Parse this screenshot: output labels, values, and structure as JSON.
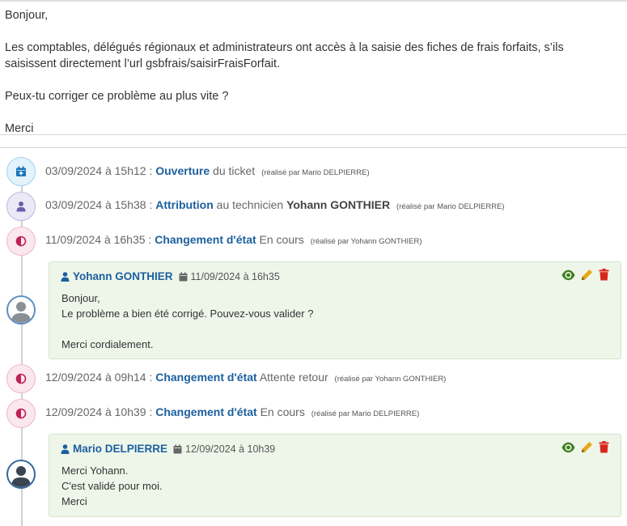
{
  "message": {
    "greeting": "Bonjour,",
    "line1": "Les comptables, délégués régionaux et administrateurs ont accès à la saisie des fiches de frais forfaits, s’ils",
    "line2": "saisissent directement l’url gsbfrais/saisirFraisForfait.",
    "question": "Peux-tu corriger ce problème au plus vite ?",
    "thanks": "Merci"
  },
  "timeline": {
    "e1": {
      "date": "03/09/2024 à 15h12 :",
      "action": "Ouverture",
      "detail": "du ticket",
      "by": "(réalisé par Mario DELPIERRE)",
      "icon": "calendar-plus-icon",
      "color": "#1a73b8"
    },
    "e2": {
      "date": "03/09/2024 à 15h38 :",
      "action": "Attribution",
      "detail": "au technicien",
      "target": "Yohann GONTHIER",
      "by": "(réalisé par Mario DELPIERRE)",
      "icon": "user-icon",
      "color": "#6a5fa8"
    },
    "e3": {
      "date": "11/09/2024 à 16h35 :",
      "action": "Changement d'état",
      "detail": "En cours",
      "by": "(réalisé par Yohann GONTHIER)",
      "icon": "half-circle-icon",
      "color": "#c0205a"
    },
    "c1": {
      "author": "Yohann GONTHIER",
      "date": "11/09/2024 à 16h35",
      "lines": [
        "Bonjour,",
        "Le problème a bien été corrigé. Pouvez-vous valider ?",
        "",
        "Merci cordialement."
      ]
    },
    "e4": {
      "date": "12/09/2024 à 09h14 :",
      "action": "Changement d'état",
      "detail": "Attente retour",
      "by": "(réalisé par Yohann GONTHIER)",
      "icon": "half-circle-icon",
      "color": "#c0205a"
    },
    "e5": {
      "date": "12/09/2024 à 10h39 :",
      "action": "Changement d'état",
      "detail": "En cours",
      "by": "(réalisé par Mario DELPIERRE)",
      "icon": "half-circle-icon",
      "color": "#c0205a"
    },
    "c2": {
      "author": "Mario DELPIERRE",
      "date": "12/09/2024 à 10h39",
      "lines": [
        "Merci Yohann.",
        "C'est validé pour moi.",
        "Merci"
      ]
    }
  },
  "colors": {
    "view": "#3f7f1f",
    "edit": "#e6a817",
    "delete": "#d9261c",
    "link": "#1c5f9e"
  }
}
